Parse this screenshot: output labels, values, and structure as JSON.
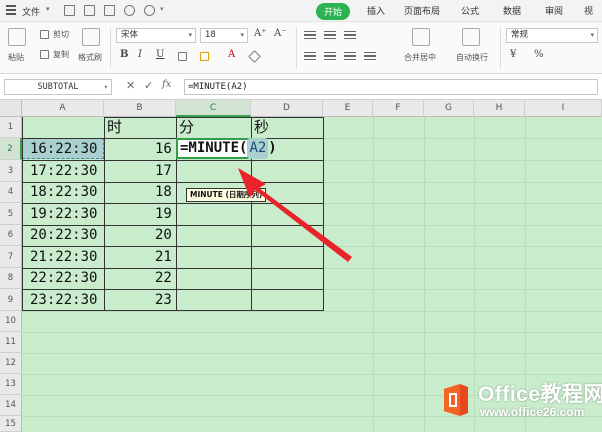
{
  "menubar": {
    "file_label": "文件",
    "tabs": [
      "开始",
      "插入",
      "页面布局",
      "公式",
      "数据",
      "审阅",
      "视"
    ],
    "active_tab": "开始"
  },
  "ribbon": {
    "paste": "粘贴",
    "cut": "剪切",
    "copy": "复制",
    "format_painter": "格式刷",
    "font_name": "宋体",
    "font_size": "18",
    "font_grow": "A⁺",
    "font_shrink": "A⁻",
    "bold": "B",
    "italic": "I",
    "underline": "U",
    "merge_center": "合并居中",
    "wrap_text": "自动换行",
    "number_format": "常规",
    "currency": "¥",
    "percent": "%"
  },
  "formula_bar": {
    "name_box": "SUBTOTAL",
    "fx": "fx",
    "formula": "=MINUTE(A2)"
  },
  "sheet": {
    "columns": [
      "A",
      "B",
      "C",
      "D",
      "E",
      "F",
      "G",
      "H",
      "I"
    ],
    "rows": [
      "1",
      "2",
      "3",
      "4",
      "5",
      "6",
      "7",
      "8",
      "9",
      "10",
      "11",
      "12",
      "13",
      "14",
      "15"
    ],
    "header_b": "时",
    "header_c": "分",
    "header_d": "秒",
    "times": [
      "16:22:30",
      "17:22:30",
      "18:22:30",
      "19:22:30",
      "20:22:30",
      "21:22:30",
      "22:22:30",
      "23:22:30"
    ],
    "hours": [
      "16",
      "17",
      "18",
      "19",
      "20",
      "21",
      "22",
      "23"
    ],
    "edit_prefix": "=MINUTE(",
    "edit_ref": "A2",
    "edit_suffix": ")",
    "tooltip": "MINUTE (日期序列)"
  },
  "watermark": {
    "title": "Office教程网",
    "url": "www.office26.com"
  },
  "colors": {
    "accent": "#2ab350",
    "sheet_bg": "#c9eccd",
    "arrow": "#e8232a"
  }
}
